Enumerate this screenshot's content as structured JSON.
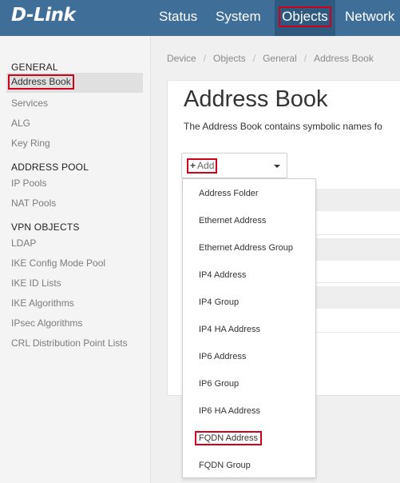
{
  "header": {
    "logo": "D-Link",
    "tabs": [
      {
        "label": "Status"
      },
      {
        "label": "System"
      },
      {
        "label": "Objects"
      },
      {
        "label": "Network"
      }
    ]
  },
  "sidebar": {
    "sections": [
      {
        "title": "GENERAL",
        "items": [
          "Address Book",
          "Services",
          "ALG",
          "Key Ring"
        ]
      },
      {
        "title": "ADDRESS POOL",
        "items": [
          "IP Pools",
          "NAT Pools"
        ]
      },
      {
        "title": "VPN OBJECTS",
        "items": [
          "LDAP",
          "IKE Config Mode Pool",
          "IKE ID Lists",
          "IKE Algorithms",
          "IPsec Algorithms",
          "CRL Distribution Point Lists"
        ]
      }
    ]
  },
  "breadcrumb": [
    "Device",
    "Objects",
    "General",
    "Address Book"
  ],
  "page": {
    "title": "Address Book",
    "description": "The Address Book contains symbolic names fo"
  },
  "add_button": {
    "plus": "+",
    "label": "Add"
  },
  "dropdown": {
    "items": [
      "Address Folder",
      "Ethernet Address",
      "Ethernet Address Group",
      "IP4 Address",
      "IP4 Group",
      "IP4 HA Address",
      "IP6 Address",
      "IP6 Group",
      "IP6 HA Address",
      "FQDN Address",
      "FQDN Group"
    ]
  }
}
